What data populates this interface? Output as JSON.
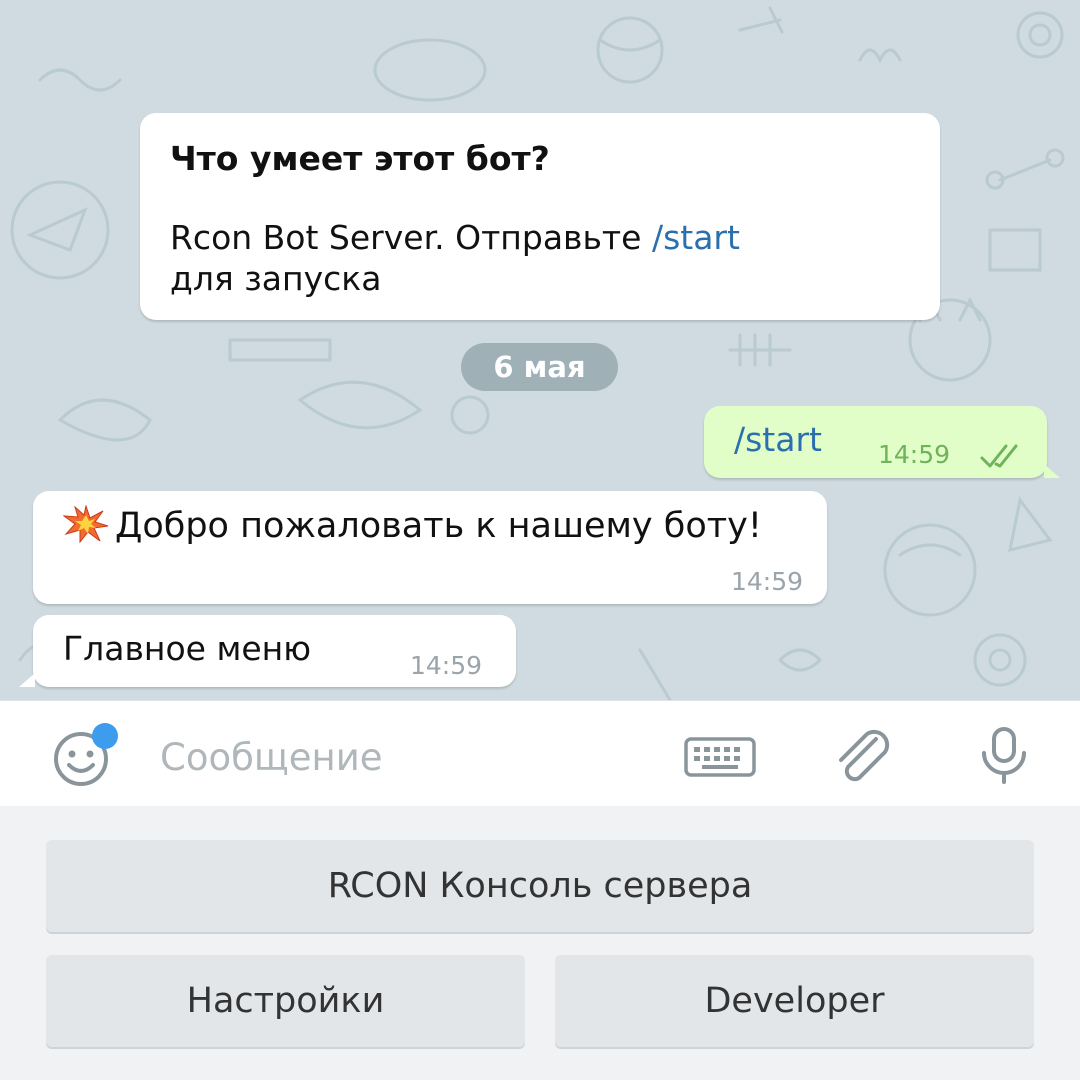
{
  "info_card": {
    "title": "Что умеет этот бот?",
    "body_prefix": "Rcon Bot Server. Отправьте ",
    "body_link": "/start",
    "body_suffix": "для запуска"
  },
  "date_divider": "6 мая",
  "outgoing": {
    "text": "/start",
    "time": "14:59",
    "status_icon": "double-check-icon"
  },
  "incoming": [
    {
      "emoji": "collision-emoji",
      "text": "Добро пожаловать к нашему боту!",
      "time": "14:59"
    },
    {
      "text": "Главное меню",
      "time": "14:59"
    }
  ],
  "composer": {
    "placeholder": "Сообщение",
    "icons": [
      "smile-icon",
      "keyboard-icon",
      "paperclip-icon",
      "microphone-icon"
    ],
    "badge_color": "#3e9cee"
  },
  "bot_keyboard": {
    "row1": [
      "RCON Консоль сервера"
    ],
    "row2": [
      "Настройки",
      "Developer"
    ]
  },
  "colors": {
    "chat_background": "#cfdbe0",
    "outgoing_bubble": "#e1fdc8",
    "link": "#2b6fae",
    "check": "#6fb35a"
  }
}
